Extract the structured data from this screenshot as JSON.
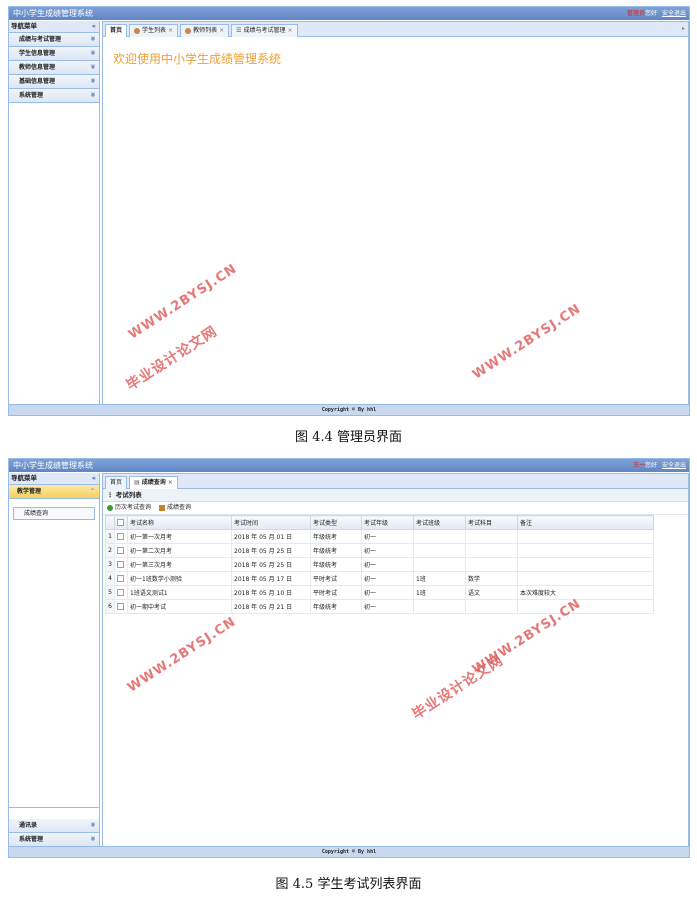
{
  "screen1": {
    "app_title": "中小学生成绩管理系统",
    "user_name": "管理员",
    "greeting": "您好",
    "logout": "安全退出",
    "nav_header": "导航菜单",
    "nav_items": [
      "成绩与考试管理",
      "学生信息管理",
      "教师信息管理",
      "基础信息管理",
      "系统管理"
    ],
    "tabs": [
      {
        "label": "首页",
        "closable": false
      },
      {
        "label": "学生列表",
        "closable": true
      },
      {
        "label": "教师列表",
        "closable": true
      },
      {
        "label": "成绩与考试管理",
        "closable": true
      }
    ],
    "welcome_text": "欢迎使用中小学生成绩管理系统",
    "footer": "Copyright © By hhl",
    "caption": "图 4.4 管理员界面"
  },
  "screen2": {
    "app_title": "中小学生成绩管理系统",
    "user_name": "王一",
    "greeting": "您好",
    "logout": "安全退出",
    "nav_header": "导航菜单",
    "active_section": "教学管理",
    "active_link": "成绩查询",
    "bottom_sections": [
      "通讯录",
      "系统管理"
    ],
    "tabs": [
      {
        "label": "首页",
        "closable": false
      },
      {
        "label": "成绩查询",
        "closable": true
      }
    ],
    "panel_title": "考试列表",
    "toolbar": [
      "历次考试查询",
      "成绩查询"
    ],
    "columns": [
      "考试名称",
      "考试时间",
      "考试类型",
      "考试年级",
      "考试班级",
      "考试科目",
      "备注"
    ],
    "rows": [
      [
        "初一第一次月考",
        "2018 年 05 月 01 日",
        "年级统考",
        "初一",
        "",
        "",
        ""
      ],
      [
        "初一第二次月考",
        "2018 年 05 月 25 日",
        "年级统考",
        "初一",
        "",
        "",
        ""
      ],
      [
        "初一第三次月考",
        "2018 年 05 月 25 日",
        "年级统考",
        "初一",
        "",
        "",
        ""
      ],
      [
        "初一1班数学小测验",
        "2018 年 05 月 17 日",
        "平时考试",
        "初一",
        "1班",
        "数学",
        ""
      ],
      [
        "1班语文测试1",
        "2018 年 05 月 10 日",
        "平时考试",
        "初一",
        "1班",
        "语文",
        "本次难度较大"
      ],
      [
        "初一期中考试",
        "2018 年 05 月 21 日",
        "年级统考",
        "初一",
        "",
        "",
        ""
      ]
    ],
    "footer": "Copyright © By hhl",
    "caption": "图 4.5 学生考试列表界面"
  },
  "watermarks": {
    "url": "WWW.2BYSJ.CN",
    "site": "毕业设计论文网"
  },
  "colors": {
    "header": "#6a8fcb",
    "welcome": "#f0a030",
    "watermark": "#e06060",
    "accordion_active": "#f8cf5e"
  }
}
